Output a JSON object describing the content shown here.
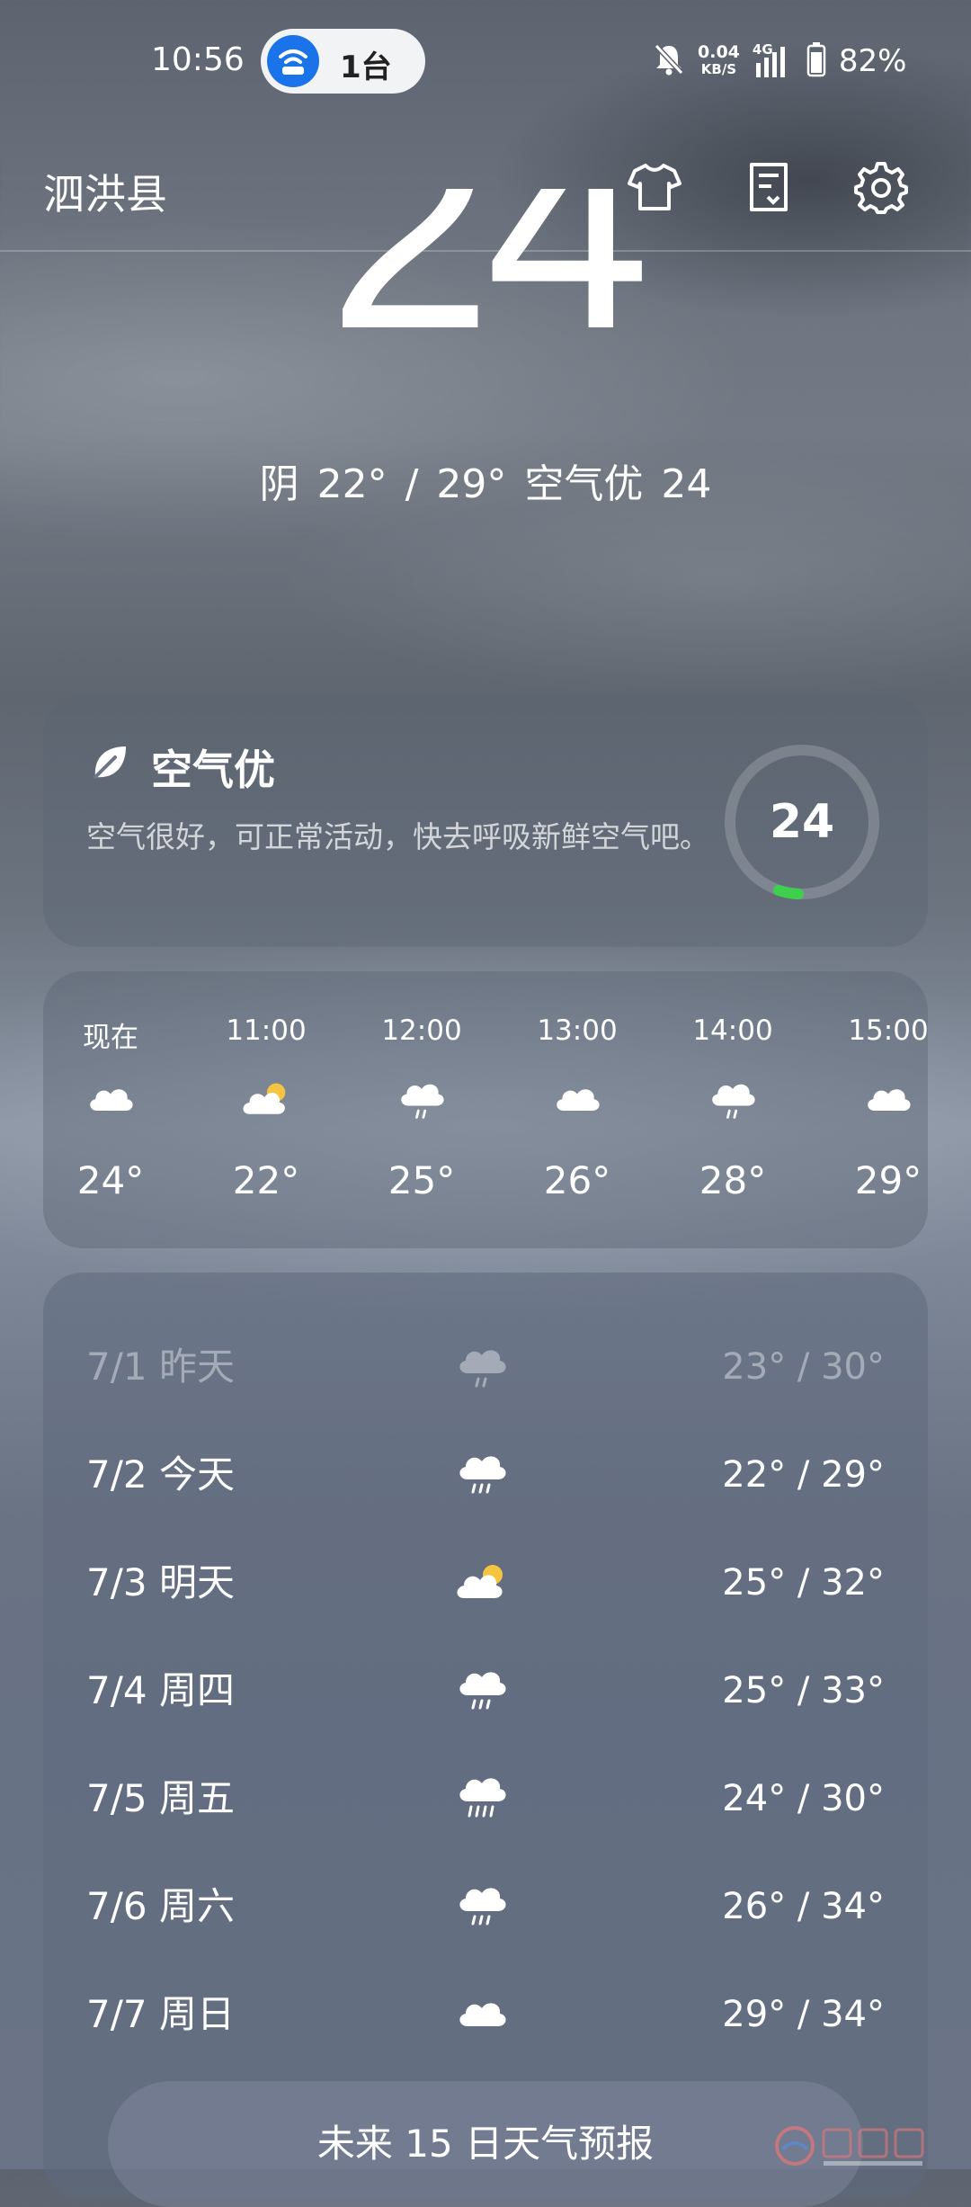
{
  "status_bar": {
    "time": "10:56",
    "hotspot_label": "1台",
    "net_speed_value": "0.04",
    "net_speed_unit": "KB/S",
    "network": "4G",
    "battery": "82%"
  },
  "header": {
    "city": "泗洪县",
    "icons": [
      "tshirt-icon",
      "document-icon",
      "gear-icon"
    ]
  },
  "current": {
    "temperature": "24",
    "summary": "阴  22° / 29°  空气优 24"
  },
  "air_quality": {
    "title": "空气优",
    "description": "空气很好，可正常活动，快去呼吸新鲜空气吧。",
    "aqi": "24",
    "aqi_fraction": 0.05,
    "accent_color": "#3ecf4c"
  },
  "hourly": [
    {
      "time": "现在",
      "icon": "cloud-icon",
      "temp": "24°"
    },
    {
      "time": "11:00",
      "icon": "partly-cloudy-icon",
      "temp": "22°"
    },
    {
      "time": "12:00",
      "icon": "light-rain-icon",
      "temp": "25°"
    },
    {
      "time": "13:00",
      "icon": "cloud-icon",
      "temp": "26°"
    },
    {
      "time": "14:00",
      "icon": "light-rain-icon",
      "temp": "28°"
    },
    {
      "time": "15:00",
      "icon": "cloud-icon",
      "temp": "29°"
    }
  ],
  "daily": [
    {
      "date": "7/1",
      "day": "昨天",
      "icon": "light-rain-icon",
      "low": "23°",
      "high": "30°",
      "past": true
    },
    {
      "date": "7/2",
      "day": "今天",
      "icon": "rain-icon",
      "low": "22°",
      "high": "29°",
      "past": false
    },
    {
      "date": "7/3",
      "day": "明天",
      "icon": "partly-cloudy-icon",
      "low": "25°",
      "high": "32°",
      "past": false
    },
    {
      "date": "7/4",
      "day": "周四",
      "icon": "rain-icon",
      "low": "25°",
      "high": "33°",
      "past": false
    },
    {
      "date": "7/5",
      "day": "周五",
      "icon": "heavy-rain-icon",
      "low": "24°",
      "high": "30°",
      "past": false
    },
    {
      "date": "7/6",
      "day": "周六",
      "icon": "rain-icon",
      "low": "26°",
      "high": "34°",
      "past": false
    },
    {
      "date": "7/7",
      "day": "周日",
      "icon": "cloud-icon",
      "low": "29°",
      "high": "34°",
      "past": false
    }
  ],
  "forecast_button": "未来 15 日天气预报"
}
